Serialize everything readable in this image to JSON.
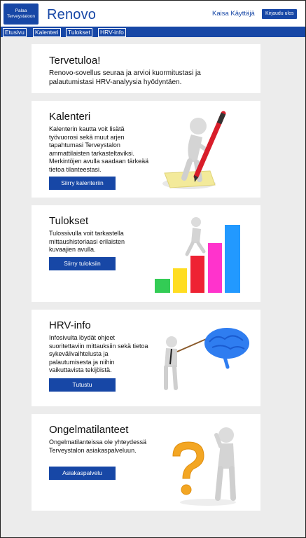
{
  "header": {
    "home_button_line1": "Palaa",
    "home_button_line2": "Terveystaloon",
    "brand": "Renovo",
    "user_name": "Kaisa Käyttäjä",
    "logout_label": "Kirjaudu ulos"
  },
  "nav": {
    "tabs": [
      {
        "label": "Etusivu"
      },
      {
        "label": "Kalenteri"
      },
      {
        "label": "Tulokset"
      },
      {
        "label": "HRV-info"
      }
    ]
  },
  "welcome": {
    "title": "Tervetuloa!",
    "text": "Renovo-sovellus seuraa ja arvioi kuormitustasi ja palautumistasi HRV-analyysia hyödyntäen."
  },
  "cards": [
    {
      "title": "Kalenteri",
      "text": "Kalenterin kautta voit lisätä työvuorosi sekä muut arjen tapahtumasi Terveystalon ammattilaisten tarkasteltaviksi. Merkintöjen avulla saadaan tärkeää tietoa tilanteestasi.",
      "button": "Siirry kalenteriin",
      "icon": "figure-with-pencil-icon"
    },
    {
      "title": "Tulokset",
      "text": "Tulossivulla voit tarkastella mittaushistoriaasi erilaisten kuvaajien avulla.",
      "button": "Siirry tuloksiin",
      "icon": "figure-climbing-bars-icon"
    },
    {
      "title": "HRV-info",
      "text": "Infosivulta löydät ohjeet suoritettaviin mittauksiin sekä tietoa sykevälivaihtelusta ja palautumisesta ja niihin vaikuttavista tekijöistä.",
      "button": "Tutustu",
      "icon": "figure-pointing-brain-icon"
    },
    {
      "title": "Ongelmatilanteet",
      "text": "Ongelmatilanteissa ole yhteydessä Terveystalon asiakaspalveluun.",
      "button": "Asiakaspalvelu",
      "icon": "figure-question-mark-icon"
    }
  ],
  "colors": {
    "brand_blue": "#1747a6",
    "page_background": "#ececec",
    "bar_colors": [
      "#33cc55",
      "#ffdd22",
      "#ee2233",
      "#ff33cc",
      "#2299ff"
    ]
  }
}
